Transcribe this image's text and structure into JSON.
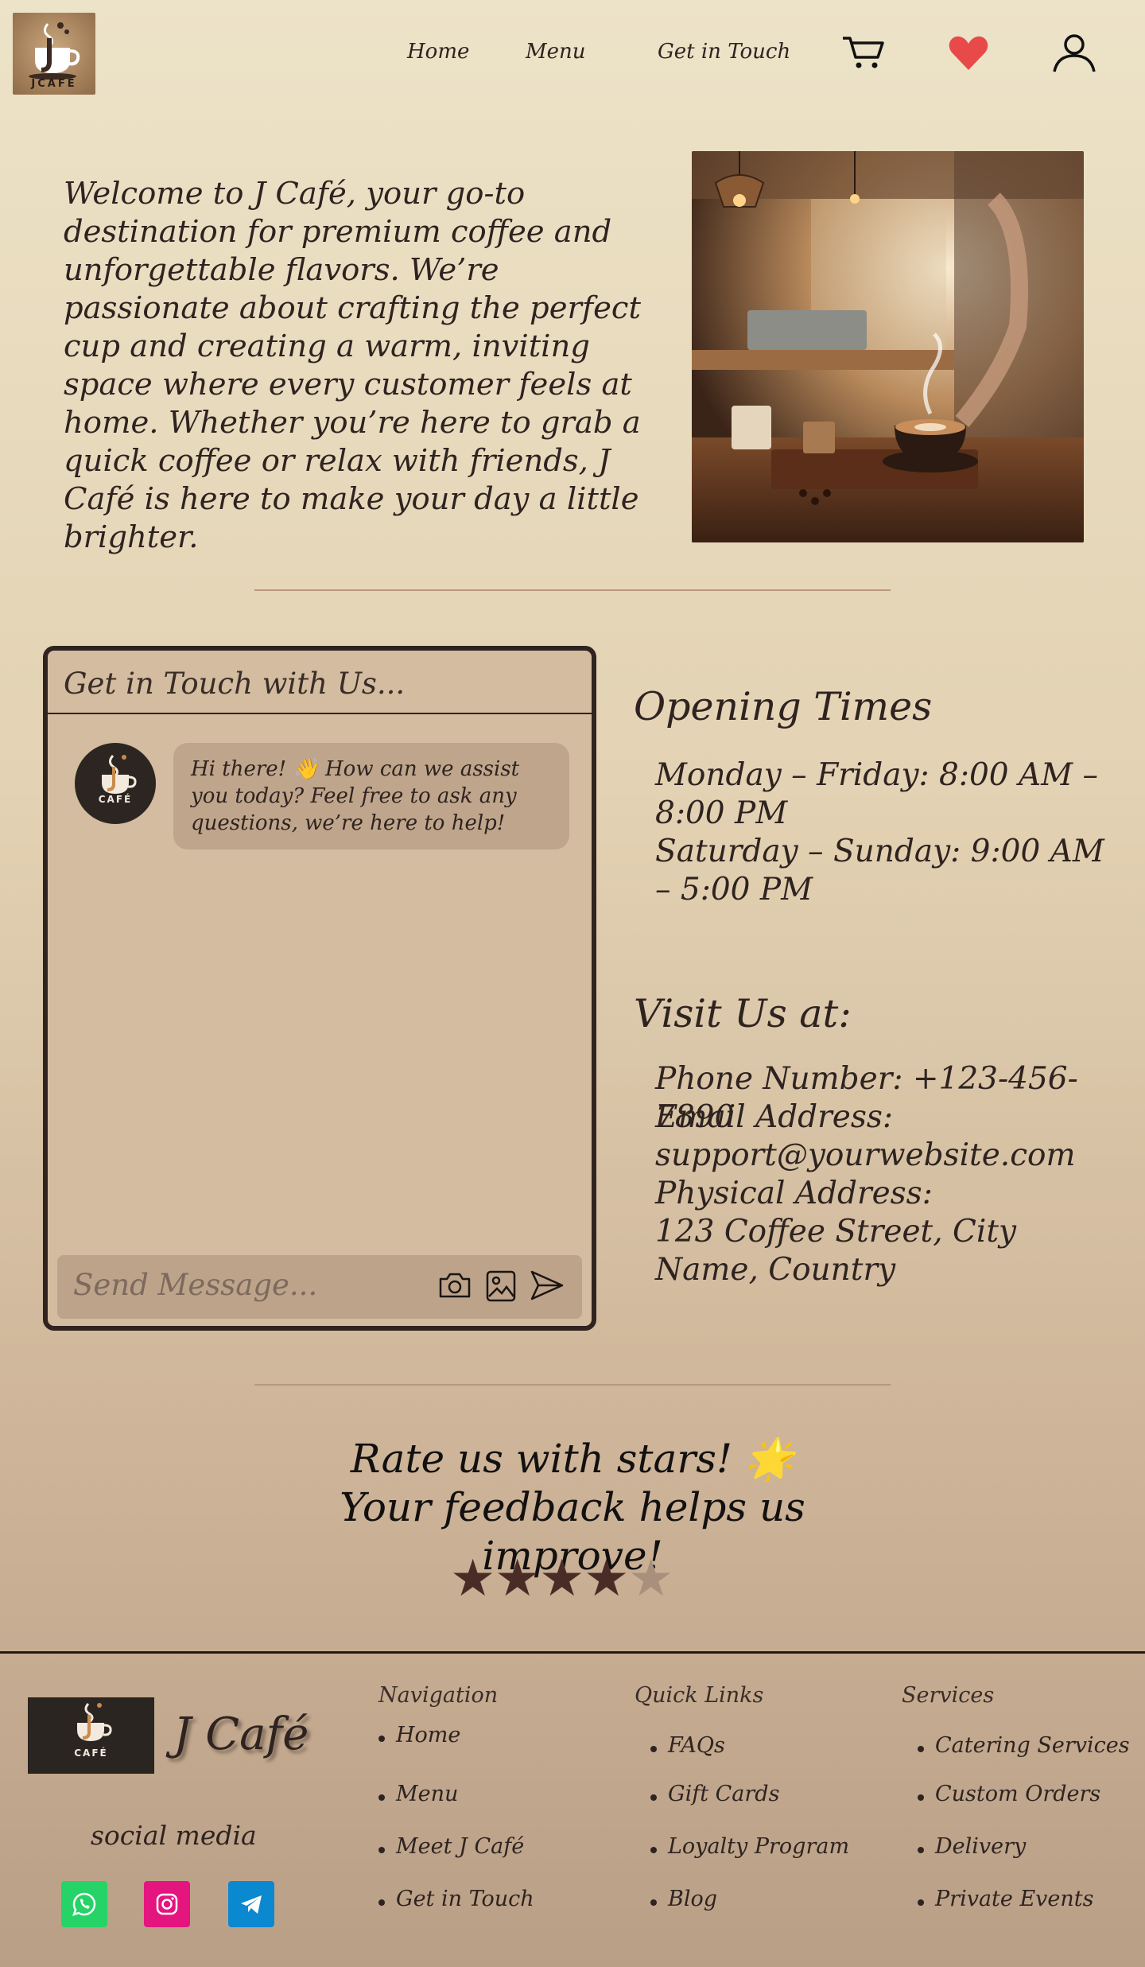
{
  "header": {
    "logo_text": "JCAFÉ",
    "nav": [
      {
        "label": "Home"
      },
      {
        "label": "Menu"
      },
      {
        "label": "Get in Touch"
      }
    ],
    "icons": [
      "cart-icon",
      "heart-icon",
      "user-icon"
    ]
  },
  "hero": {
    "welcome_text": "Welcome to J Café, your go-to destination for premium coffee and unforgettable flavors. We’re passionate about crafting the perfect cup and creating a warm, inviting space where every customer feels at home. Whether you’re here to grab a quick coffee or relax with friends, J Café is here to make your day a little brighter."
  },
  "chat": {
    "title": "Get in Touch with Us...",
    "avatar_text": "CAFÉ",
    "bot_message": "Hi there! 👋 How can we assist you today? Feel free to ask any questions, we’re here to help!",
    "input_placeholder": "Send Message...",
    "input_icons": [
      "camera-icon",
      "image-icon",
      "send-icon"
    ]
  },
  "info": {
    "opening_title": "Opening Times",
    "opening_lines": [
      "Monday – Friday: 8:00 AM – 8:00 PM",
      "Saturday – Sunday: 9:00 AM – 5:00 PM"
    ],
    "visit_title": "Visit Us at:",
    "phone": "Phone Number: +123-456-7890",
    "email_label": "Email Address:",
    "email": "support@yourwebsite.com",
    "address_label": "Physical Address:",
    "address": "123 Coffee Street, City Name, Country"
  },
  "rating": {
    "prompt": "Rate us with stars! 🌟 Your feedback helps us improve!",
    "value": 4,
    "max": 5,
    "filled_color": "#4a2c26",
    "empty_color": "#a8907c"
  },
  "footer": {
    "brand": "J Café",
    "logo_text": "CAFÉ",
    "social_label": "social media",
    "social": [
      {
        "name": "whatsapp-icon",
        "color": "#25d366"
      },
      {
        "name": "instagram-icon",
        "color": "#e4157f"
      },
      {
        "name": "telegram-icon",
        "color": "#0a88d0"
      }
    ],
    "navigation": {
      "title": "Navigation",
      "items": [
        "Home",
        "Menu",
        "Meet J Café",
        "Get in Touch"
      ]
    },
    "quick_links": {
      "title": "Quick Links",
      "items": [
        "FAQs",
        "Gift Cards",
        "Loyalty Program",
        "Blog"
      ]
    },
    "services": {
      "title": "Services",
      "items": [
        "Catering Services",
        "Custom Orders",
        "Delivery",
        "Private Events"
      ]
    }
  }
}
